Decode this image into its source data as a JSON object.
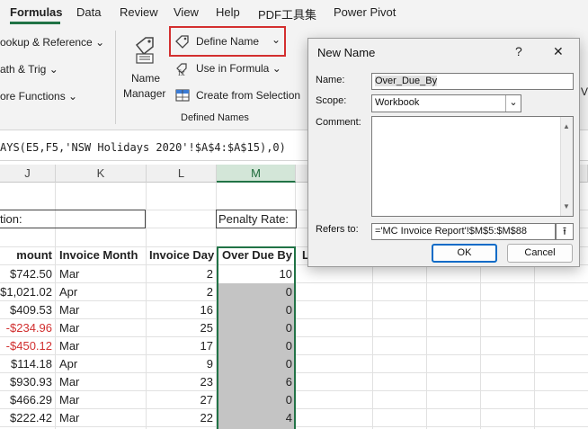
{
  "ribbon": {
    "tabs": [
      "Formulas",
      "Data",
      "Review",
      "View",
      "Help",
      "PDF工具集",
      "Power Pivot"
    ],
    "lookup_ref": "ookup & Reference",
    "math_trig": "ath & Trig",
    "more_functions": "ore Functions",
    "name_manager_line1": "Name",
    "name_manager_line2": "Manager",
    "define_name": "Define Name",
    "use_in_formula": "Use in Formula",
    "create_from_selection": "Create from Selection",
    "group_label": "Defined Names",
    "partial_v": "V"
  },
  "formula_bar": {
    "text": "AYS(E5,F5,'NSW Holidays 2020'!$A$4:$A$15),0)"
  },
  "sheet": {
    "columns": [
      "J",
      "K",
      "L",
      "M"
    ],
    "label_tion": "tion:",
    "label_penalty": "Penalty Rate:",
    "headers": {
      "amount": "mount",
      "invoice_month": "Invoice Month",
      "invoice_day": "Invoice Day",
      "over_due_by": "Over Due By",
      "partial_l": "L"
    },
    "rows": [
      {
        "amount": "$742.50",
        "month": "Mar",
        "day": "2",
        "overdue": "10"
      },
      {
        "amount": "$1,021.02",
        "month": "Apr",
        "day": "2",
        "overdue": "0"
      },
      {
        "amount": "$409.53",
        "month": "Mar",
        "day": "16",
        "overdue": "0"
      },
      {
        "amount": "-$234.96",
        "month": "Mar",
        "day": "25",
        "overdue": "0"
      },
      {
        "amount": "-$450.12",
        "month": "Mar",
        "day": "17",
        "overdue": "0"
      },
      {
        "amount": "$114.18",
        "month": "Apr",
        "day": "9",
        "overdue": "0"
      },
      {
        "amount": "$930.93",
        "month": "Mar",
        "day": "23",
        "overdue": "6"
      },
      {
        "amount": "$466.29",
        "month": "Mar",
        "day": "27",
        "overdue": "0"
      },
      {
        "amount": "$222.42",
        "month": "Mar",
        "day": "22",
        "overdue": "4"
      }
    ]
  },
  "dialog": {
    "title": "New Name",
    "help": "?",
    "close": "✕",
    "name_label": "Name:",
    "name_value": "Over_Due_By",
    "scope_label": "Scope:",
    "scope_value": "Workbook",
    "comment_label": "Comment:",
    "refers_label": "Refers to:",
    "refers_value": "='MC Invoice Report'!$M$5:$M$88",
    "ok": "OK",
    "cancel": "Cancel"
  },
  "colors": {
    "accent": "#217346",
    "highlight": "#d32f2f",
    "negative": "#d12f2f",
    "ok_border": "#0b6bc7"
  }
}
